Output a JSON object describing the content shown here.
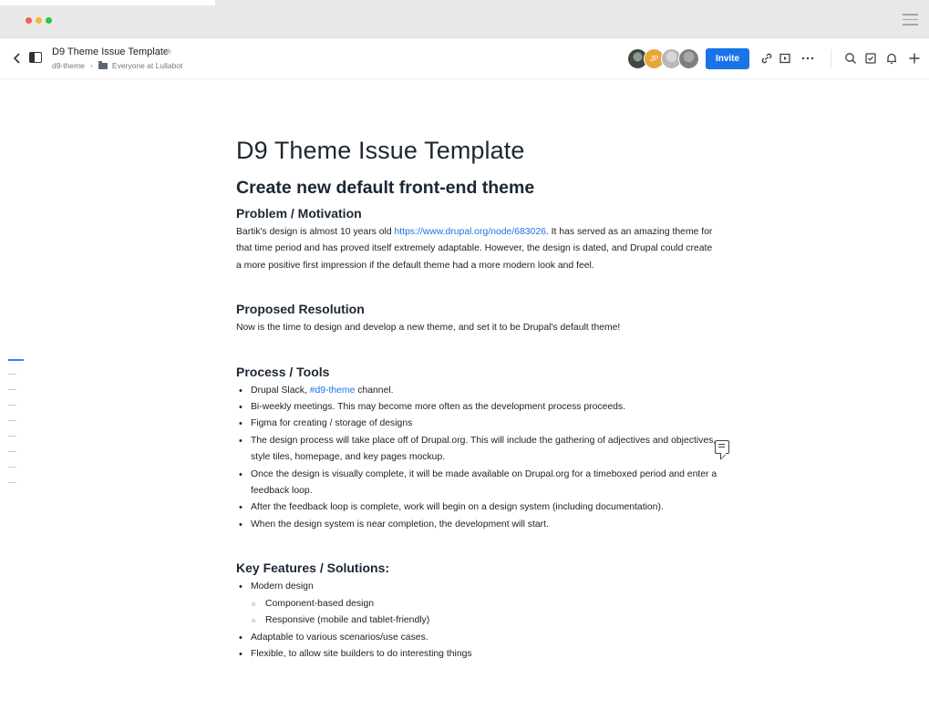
{
  "toolbar": {
    "doc_title": "D9 Theme Issue Template",
    "breadcrumb_space": "d9-theme",
    "breadcrumb_folder": "Everyone at Lullabot",
    "avatar_initials": "JP",
    "invite_label": "Invite"
  },
  "icons": {
    "back": "chevron-left-icon",
    "panel": "sidebar-toggle-icon",
    "star": "star-icon",
    "link": "link-icon",
    "present": "present-icon",
    "more": "more-icon",
    "search": "search-icon",
    "checklist": "checkbox-icon",
    "notifications": "bell-icon",
    "new": "plus-icon",
    "comment": "comment-icon"
  },
  "colors": {
    "accent": "#1a73e8",
    "avatar_jp": "#e8a53b"
  },
  "doc": {
    "title": "D9 Theme Issue Template",
    "subtitle": "Create new default front-end theme",
    "problem": {
      "heading": "Problem / Motivation",
      "text_before": "Bartik's design is almost 10 years old ",
      "link": "https://www.drupal.org/node/683026",
      "text_after": ". It has served as an amazing theme for that time period and has proved itself extremely adaptable. However, the design is dated, and Drupal could create a more positive first impression if the default theme had a more modern look and feel."
    },
    "resolution": {
      "heading": "Proposed Resolution",
      "text": "Now is the time to design and develop a new theme, and set it to be Drupal's default theme!"
    },
    "process": {
      "heading": "Process / Tools",
      "slack_before": "Drupal Slack, ",
      "slack_channel": "#d9-theme",
      "slack_after": " channel.",
      "items": [
        "Bi-weekly meetings. This may become more often as the development process proceeds.",
        "Figma for creating / storage of designs",
        "The design process will take place off of Drupal.org. This will include the gathering of adjectives and objectives, style tiles, homepage, and key pages mockup.",
        "Once the design is visually complete, it will be made available on Drupal.org for a timeboxed period and enter a feedback loop.",
        "After the feedback loop is complete, work will begin on a design system (including documentation).",
        "When the design system is near completion, the development will start."
      ]
    },
    "features": {
      "heading": "Key Features / Solutions:",
      "item1": "Modern design",
      "sub1": "Component-based design",
      "sub2": "Responsive (mobile and tablet-friendly)",
      "item2": "Adaptable to various scenarios/use cases.",
      "item3": "Flexible, to allow site builders to do interesting things"
    }
  }
}
